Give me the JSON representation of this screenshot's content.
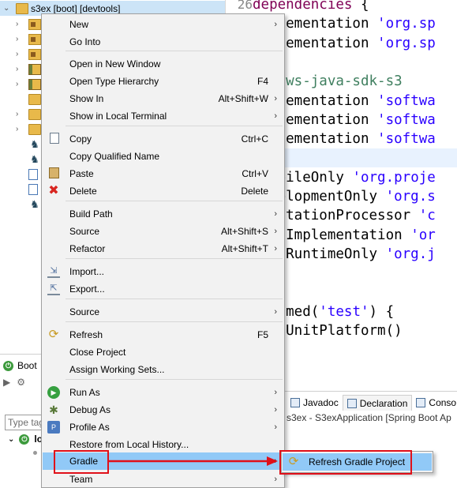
{
  "tree": {
    "root_label": "s3ex [boot] [devtools]"
  },
  "boot_dashboard": {
    "tab_label": "Boot",
    "filter_placeholder": "Type tag",
    "app_label": "lo"
  },
  "editor": {
    "lines": [
      {
        "num": "26",
        "parts": [
          {
            "t": "dependencies",
            "c": "kw"
          },
          {
            "t": " {",
            "c": ""
          }
        ]
      },
      {
        "num": "",
        "parts": [
          {
            "t": "implementation ",
            "c": ""
          },
          {
            "t": "'org.sp",
            "c": "str"
          }
        ]
      },
      {
        "num": "",
        "parts": [
          {
            "t": "implementation ",
            "c": ""
          },
          {
            "t": "'org.sp",
            "c": "str"
          }
        ]
      },
      {
        "num": "",
        "parts": []
      },
      {
        "num": "",
        "parts": [
          {
            "t": "// aws-java-sdk-s3",
            "c": "cmt"
          }
        ]
      },
      {
        "num": "",
        "parts": [
          {
            "t": "implementation ",
            "c": ""
          },
          {
            "t": "'softwa",
            "c": "str"
          }
        ]
      },
      {
        "num": "",
        "parts": [
          {
            "t": "implementation ",
            "c": ""
          },
          {
            "t": "'softwa",
            "c": "str"
          }
        ]
      },
      {
        "num": "",
        "parts": [
          {
            "t": "implementation ",
            "c": ""
          },
          {
            "t": "'softwa",
            "c": "str"
          }
        ]
      },
      {
        "num": "",
        "parts": []
      },
      {
        "num": "",
        "parts": [
          {
            "t": "compileOnly ",
            "c": ""
          },
          {
            "t": "'org.proje",
            "c": "str"
          }
        ]
      },
      {
        "num": "",
        "parts": [
          {
            "t": "developmentOnly ",
            "c": ""
          },
          {
            "t": "'org.s",
            "c": "str"
          }
        ]
      },
      {
        "num": "",
        "parts": [
          {
            "t": "annotationProcessor ",
            "c": ""
          },
          {
            "t": "'c",
            "c": "str"
          }
        ]
      },
      {
        "num": "",
        "parts": [
          {
            "t": "testImplementation ",
            "c": ""
          },
          {
            "t": "'or",
            "c": "str"
          }
        ]
      },
      {
        "num": "",
        "parts": [
          {
            "t": "testRuntimeOnly ",
            "c": ""
          },
          {
            "t": "'org.j",
            "c": "str"
          }
        ]
      },
      {
        "num": "",
        "parts": []
      },
      {
        "num": "",
        "parts": []
      },
      {
        "num": "",
        "parts": [
          {
            "t": "s.named(",
            "c": ""
          },
          {
            "t": "'test'",
            "c": "str"
          },
          {
            "t": ") {",
            "c": ""
          }
        ]
      },
      {
        "num": "",
        "parts": [
          {
            "t": "useJUnitPlatform()",
            "c": ""
          }
        ]
      }
    ]
  },
  "console": {
    "tabs": [
      {
        "label": "Javadoc",
        "icon": "javadoc-icon"
      },
      {
        "label": "Declaration",
        "icon": "declaration-icon"
      },
      {
        "label": "Conso",
        "icon": "console-icon"
      }
    ],
    "status": "s3ex - S3exApplication [Spring Boot Ap"
  },
  "context_menu": {
    "items": [
      {
        "label": "New",
        "shortcut": "",
        "submenu": true
      },
      {
        "label": "Go Into",
        "shortcut": "",
        "submenu": false
      },
      {
        "label": "Open in New Window",
        "shortcut": "",
        "submenu": false
      },
      {
        "label": "Open Type Hierarchy",
        "shortcut": "F4",
        "submenu": false
      },
      {
        "label": "Show In",
        "shortcut": "Alt+Shift+W",
        "submenu": true
      },
      {
        "label": "Show in Local Terminal",
        "shortcut": "",
        "submenu": true
      },
      {
        "label": "Copy",
        "shortcut": "Ctrl+C",
        "submenu": false,
        "icon": "copy-icon"
      },
      {
        "label": "Copy Qualified Name",
        "shortcut": "",
        "submenu": false
      },
      {
        "label": "Paste",
        "shortcut": "Ctrl+V",
        "submenu": false,
        "icon": "paste-icon"
      },
      {
        "label": "Delete",
        "shortcut": "Delete",
        "submenu": false,
        "icon": "delete-icon"
      },
      {
        "label": "Build Path",
        "shortcut": "",
        "submenu": true
      },
      {
        "label": "Source",
        "shortcut": "Alt+Shift+S",
        "submenu": true
      },
      {
        "label": "Refactor",
        "shortcut": "Alt+Shift+T",
        "submenu": true
      },
      {
        "label": "Import...",
        "shortcut": "",
        "submenu": false,
        "icon": "import-icon"
      },
      {
        "label": "Export...",
        "shortcut": "",
        "submenu": false,
        "icon": "export-icon"
      },
      {
        "label": "Source",
        "shortcut": "",
        "submenu": true
      },
      {
        "label": "Refresh",
        "shortcut": "F5",
        "submenu": false,
        "icon": "refresh-icon"
      },
      {
        "label": "Close Project",
        "shortcut": "",
        "submenu": false
      },
      {
        "label": "Assign Working Sets...",
        "shortcut": "",
        "submenu": false
      },
      {
        "label": "Run As",
        "shortcut": "",
        "submenu": true,
        "icon": "run-icon"
      },
      {
        "label": "Debug As",
        "shortcut": "",
        "submenu": true,
        "icon": "debug-icon"
      },
      {
        "label": "Profile As",
        "shortcut": "",
        "submenu": true,
        "icon": "profile-icon"
      },
      {
        "label": "Restore from Local History...",
        "shortcut": "",
        "submenu": false
      },
      {
        "label": "Gradle",
        "shortcut": "",
        "submenu": true,
        "selected": true
      },
      {
        "label": "Team",
        "shortcut": "",
        "submenu": true
      }
    ],
    "submenu_arrow": "›"
  },
  "gradle_submenu": {
    "item_label": "Refresh Gradle Project"
  },
  "colors": {
    "selection": "#91c9f7",
    "annotation_red": "#e0101a",
    "menu_bg": "#f2f2f2"
  }
}
